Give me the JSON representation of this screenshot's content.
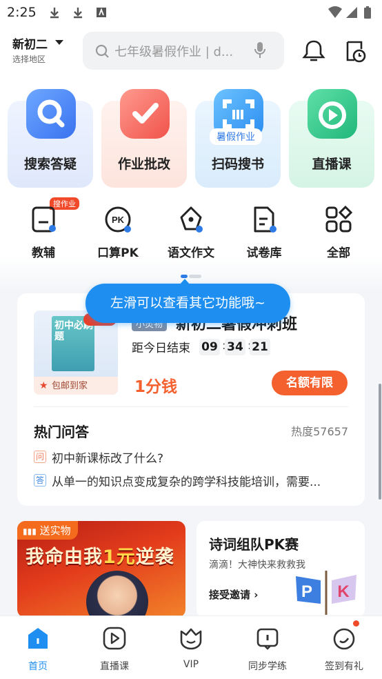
{
  "status_bar": {
    "time": "2:25"
  },
  "header": {
    "grade": "新初二",
    "region": "选择地区",
    "search_placeholder": "七年级暑假作业 | d..."
  },
  "tiles": [
    {
      "label": "搜索答疑",
      "icon": "search-icon"
    },
    {
      "label": "作业批改",
      "icon": "check-icon"
    },
    {
      "label": "扫码搜书",
      "icon": "scan-icon",
      "badge": "暑假作业"
    },
    {
      "label": "直播课",
      "icon": "play-icon"
    }
  ],
  "functions": [
    {
      "label": "教辅",
      "icon": "book-icon",
      "tag": "搜作业"
    },
    {
      "label": "口算PK",
      "icon": "pk-icon"
    },
    {
      "label": "语文作文",
      "icon": "pen-nib-icon"
    },
    {
      "label": "试卷库",
      "icon": "paper-icon"
    },
    {
      "label": "全部",
      "icon": "grid-icon"
    }
  ],
  "tooltip": "左滑可以查看其它功能哦~",
  "promo": {
    "book_title": "初中必刷题",
    "book_footer": "包邮到家",
    "tag": "小灵物",
    "title": "新初二暑假冲刺班",
    "countdown_label": "距今日结束",
    "countdown": [
      "09",
      "34",
      "21"
    ],
    "price": "1分钱",
    "button": "名额有限"
  },
  "hot": {
    "title": "热门问答",
    "heat": "热度57657",
    "q_mark": "问",
    "question": "初中新课标改了什么?",
    "a_mark": "答",
    "answer": "从单一的知识点变成复杂的跨学科技能培训，需要..."
  },
  "banner_left": {
    "tag": "送实物",
    "title_a": "我命由我",
    "title_b": "1元",
    "title_c": "逆袭"
  },
  "banner_right": {
    "title": "诗词组队PK赛",
    "subtitle": "滴滴！大神快来救救我",
    "button": "接受邀请 ›"
  },
  "tabbar": [
    {
      "label": "首页",
      "active": true
    },
    {
      "label": "直播课"
    },
    {
      "label": "VIP"
    },
    {
      "label": "同步学练"
    },
    {
      "label": "签到有礼"
    }
  ],
  "colors": {
    "accent": "#1e8ff0",
    "orange": "#f5612e",
    "red": "#f04a2b"
  }
}
